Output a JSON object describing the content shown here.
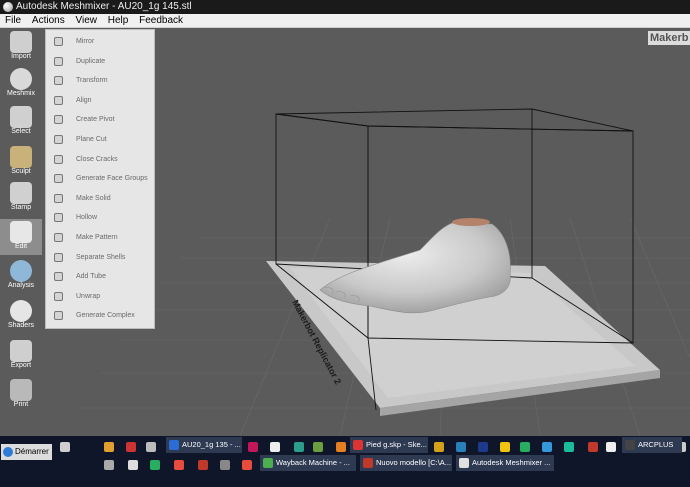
{
  "window": {
    "title": "Autodesk Meshmixer - AU20_1g 145.stl"
  },
  "menu": [
    "File",
    "Actions",
    "View",
    "Help",
    "Feedback"
  ],
  "viewport": {
    "logo_text": "Makerb",
    "plate_label": "Makerbot Replicator 2"
  },
  "toolbar": [
    {
      "label": "Import",
      "icon": "plus-icon",
      "active": false
    },
    {
      "label": "Meshmix",
      "icon": "meshmix-icon",
      "active": false
    },
    {
      "label": "Select",
      "icon": "select-arrow-icon",
      "active": false
    },
    {
      "label": "Sculpt",
      "icon": "brush-icon",
      "active": false
    },
    {
      "label": "Stamp",
      "icon": "stamp-icon",
      "active": false
    },
    {
      "label": "Edit",
      "icon": "edit-icon",
      "active": true
    },
    {
      "label": "Analysis",
      "icon": "analysis-icon",
      "active": false
    },
    {
      "label": "Shaders",
      "icon": "shader-ball-icon",
      "active": false
    },
    {
      "label": "Export",
      "icon": "export-icon",
      "active": false
    },
    {
      "label": "Print",
      "icon": "print-icon",
      "active": false
    }
  ],
  "edit_menu": [
    "Mirror",
    "Duplicate",
    "Transform",
    "Align",
    "Create Pivot",
    "Plane Cut",
    "Close Cracks",
    "Generate Face Groups",
    "Make Solid",
    "Hollow",
    "Make Pattern",
    "Separate Shells",
    "Add Tube",
    "Unwrap",
    "Generate Complex"
  ],
  "taskbar": {
    "start_label": "Démarrer",
    "row1_buttons": [
      {
        "label": "AU20_1g 135 - ...",
        "color": "#2b6cd6"
      },
      {
        "label": "Pied g.skp - Ske...",
        "color": "#d33"
      },
      {
        "label": "ARCPLUS",
        "color": "#444"
      }
    ],
    "row2_buttons": [
      {
        "label": "Wayback Machine - ...",
        "color": "#4caf50"
      },
      {
        "label": "Nuovo modello [C:\\A...",
        "color": "#c0392b"
      },
      {
        "label": "Autodesk Meshmixer ...",
        "color": "#e0e0e0"
      }
    ]
  },
  "colors": {
    "viewport_bg": "#5b5b5b",
    "panel_bg": "#e6e6e6",
    "taskbar_bg": "#0f1629",
    "foot": "#d2d2d2",
    "plate": "#c8c8c8"
  }
}
